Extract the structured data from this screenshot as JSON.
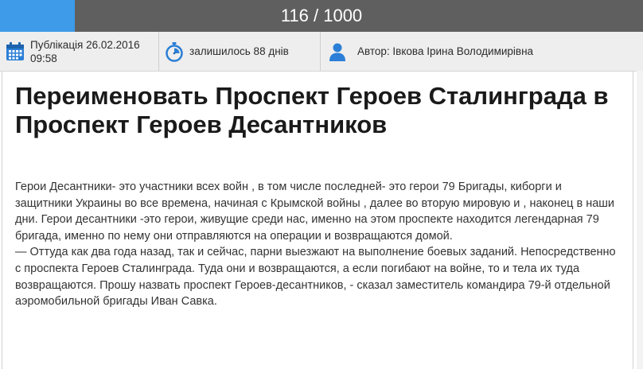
{
  "progress": {
    "text": "116 / 1000",
    "current": 116,
    "total": 1000,
    "fill_color": "#3d9be9",
    "track_color": "#5f5f5f"
  },
  "meta": {
    "published": "Публікація 26.02.2016",
    "published_time": "09:58",
    "remaining": "залишилось 88 днів",
    "author": "Автор: Івкова Ірина Володимирівна",
    "icons": [
      "calendar-icon",
      "stopwatch-icon",
      "user-icon"
    ],
    "icon_color": "#2b7fd6"
  },
  "petition": {
    "title": "Переименовать Проспект Героев Сталинграда в Проспект Героев Десантников",
    "body": [
      "Герои Десантники- это участники всех войн , в том числе последней- это герои 79 Бригады, киборги и защитники Украины во все времена, начиная с Крымской войны , далее во вторую мировую и , наконец в наши дни. Герои десантники -это герои, живущие среди нас, именно на этом проспекте находится легендарная 79 бригада, именно по нему они отправляются на операции и возвращаются домой.",
      "— Оттуда как два года назад, так и сейчас, парни выезжают на выполнение боевых заданий. Непосредственно с проспекта Героев Сталинграда. Туда они и возвращаются, а если погибают на войне, то и тела их туда возвращаются. Прошу назвать проспект Героев-десантников, - сказал заместитель командира 79-й отдельной аэромобильной бригады Иван Савка."
    ]
  }
}
